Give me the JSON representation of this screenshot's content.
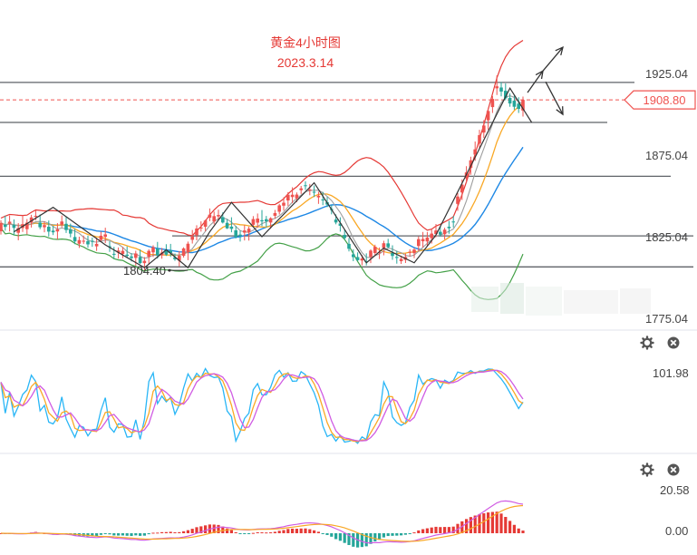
{
  "chart_data": [
    {
      "type": "candlestick",
      "title": "黄金4小时图",
      "subtitle": "2023.3.14",
      "y_ticks": [
        {
          "value": 1925,
          "label": "1925.04"
        },
        {
          "value": 1875,
          "label": "1875.04"
        },
        {
          "value": 1825,
          "label": "1825.04"
        },
        {
          "value": 1775,
          "label": "1775.04"
        }
      ],
      "ylim": [
        1771,
        1941
      ],
      "current_price": {
        "value": 1908.8,
        "label": "1908.80"
      },
      "low_marker": {
        "value": 1804.4,
        "label": "1804.40"
      },
      "horizontal_levels": [
        1919.5,
        1895,
        1862,
        1825.5,
        1806.5
      ],
      "candles_ohlc": [
        [
          1828.3,
          1835.1,
          1826.3,
          1833.4
        ],
        [
          1832.4,
          1837.9,
          1828.7,
          1831.0
        ],
        [
          1833.0,
          1838.0,
          1828.2,
          1834.2
        ],
        [
          1832.3,
          1835.6,
          1826.0,
          1830.4
        ],
        [
          1827.4,
          1833.3,
          1822.8,
          1830.3
        ],
        [
          1830.3,
          1838.1,
          1827.9,
          1832.7
        ],
        [
          1829.6,
          1835.8,
          1826.5,
          1833.6
        ],
        [
          1833.6,
          1838.4,
          1830.6,
          1836.8
        ],
        [
          1837.2,
          1841.2,
          1835.1,
          1837.8
        ],
        [
          1833.6,
          1838.6,
          1829.6,
          1830.8
        ],
        [
          1830.8,
          1834.4,
          1827.7,
          1832.1
        ],
        [
          1831.1,
          1834.9,
          1825.1,
          1828.1
        ],
        [
          1828.7,
          1831.6,
          1826.0,
          1827.7
        ],
        [
          1828.2,
          1833.3,
          1823.2,
          1829.5
        ],
        [
          1832.4,
          1838.0,
          1830.7,
          1834.3
        ],
        [
          1832.9,
          1837.4,
          1827.3,
          1829.1
        ],
        [
          1829.4,
          1833.0,
          1824.6,
          1826.9
        ],
        [
          1824.8,
          1829.8,
          1820.4,
          1822.1
        ],
        [
          1820.7,
          1825.0,
          1818.1,
          1822.9
        ],
        [
          1822.4,
          1825.7,
          1820.5,
          1822.5
        ],
        [
          1822.3,
          1825.6,
          1818.2,
          1820.3
        ],
        [
          1822.5,
          1824.5,
          1818.8,
          1821.9
        ],
        [
          1819.1,
          1824.4,
          1816.3,
          1820.6
        ],
        [
          1823.0,
          1828.1,
          1821.7,
          1825.6
        ],
        [
          1824.9,
          1830.5,
          1821.1,
          1826.4
        ],
        [
          1819.2,
          1822.2,
          1815.7,
          1819.0
        ],
        [
          1814.5,
          1818.8,
          1811.4,
          1814.4
        ],
        [
          1815.2,
          1818.4,
          1811.6,
          1816.5
        ],
        [
          1814.4,
          1818.6,
          1811.8,
          1816.3
        ],
        [
          1814.0,
          1819.0,
          1812.0,
          1813.2
        ],
        [
          1812.9,
          1814.9,
          1809.8,
          1811.9
        ],
        [
          1812.0,
          1816.4,
          1807.3,
          1814.7
        ],
        [
          1812.6,
          1817.2,
          1808.3,
          1808.8
        ],
        [
          1808.8,
          1812.5,
          1804.4,
          1810.2
        ],
        [
          1812.7,
          1817.3,
          1807.8,
          1816.3
        ],
        [
          1815.4,
          1819.7,
          1812.6,
          1818.6
        ],
        [
          1817.6,
          1821.8,
          1811.6,
          1813.6
        ],
        [
          1813.6,
          1818.1,
          1811.5,
          1815.3
        ],
        [
          1816.9,
          1820.4,
          1813.2,
          1814.0
        ],
        [
          1816.6,
          1820.6,
          1812.6,
          1815.0
        ],
        [
          1812.4,
          1814.7,
          1810.2,
          1811.2
        ],
        [
          1810.3,
          1816.2,
          1806.8,
          1813.3
        ],
        [
          1813.3,
          1818.5,
          1812.2,
          1817.8
        ],
        [
          1815.4,
          1822.0,
          1810.6,
          1820.7
        ],
        [
          1823.1,
          1829.1,
          1820.8,
          1825.1
        ],
        [
          1825.9,
          1832.0,
          1822.8,
          1830.0
        ],
        [
          1830.2,
          1834.4,
          1828.1,
          1830.6
        ],
        [
          1831.1,
          1835.4,
          1828.3,
          1834.9
        ],
        [
          1836.6,
          1842.3,
          1834.5,
          1838.5
        ],
        [
          1834.3,
          1840.4,
          1832.6,
          1837.6
        ],
        [
          1837.4,
          1841.5,
          1834.9,
          1838.3
        ],
        [
          1837.0,
          1839.9,
          1833.1,
          1833.7
        ],
        [
          1833.5,
          1835.7,
          1829.7,
          1830.1
        ],
        [
          1831.2,
          1836.9,
          1827.7,
          1829.8
        ],
        [
          1828.9,
          1831.6,
          1823.9,
          1824.7
        ],
        [
          1826.3,
          1828.7,
          1822.0,
          1825.4
        ],
        [
          1827.5,
          1832.1,
          1822.7,
          1828.8
        ],
        [
          1827.6,
          1831.2,
          1822.6,
          1829.9
        ],
        [
          1832.3,
          1837.6,
          1830.8,
          1835.8
        ],
        [
          1833.6,
          1839.2,
          1830.4,
          1836.1
        ],
        [
          1835.1,
          1841.3,
          1831.4,
          1834.4
        ],
        [
          1835.7,
          1837.7,
          1830.7,
          1834.4
        ],
        [
          1833.7,
          1836.9,
          1829.9,
          1836.3
        ],
        [
          1837.8,
          1841.4,
          1836.0,
          1839.5
        ],
        [
          1840.3,
          1845.1,
          1838.6,
          1844.2
        ],
        [
          1844.0,
          1849.2,
          1841.0,
          1845.8
        ],
        [
          1847.2,
          1852.3,
          1843.8,
          1850.7
        ],
        [
          1849.3,
          1855.3,
          1845.5,
          1850.7
        ],
        [
          1848.5,
          1852.1,
          1846.1,
          1850.8
        ],
        [
          1853.5,
          1856.1,
          1851.2,
          1854.6
        ],
        [
          1856.5,
          1858.9,
          1853.6,
          1856.1
        ],
        [
          1853.3,
          1857.3,
          1850.4,
          1853.9
        ],
        [
          1852.5,
          1856.4,
          1849.3,
          1852.2
        ],
        [
          1849.1,
          1852.6,
          1845.1,
          1850.1
        ],
        [
          1847.8,
          1852.4,
          1844.3,
          1847.4
        ],
        [
          1846.1,
          1849.3,
          1843.1,
          1844.7
        ],
        [
          1842.0,
          1844.6,
          1838.7,
          1841.3
        ],
        [
          1835.5,
          1838.7,
          1832.6,
          1833.7
        ],
        [
          1833.1,
          1836.9,
          1828.1,
          1831.7
        ],
        [
          1826.1,
          1829.5,
          1823.2,
          1824.2
        ],
        [
          1820.6,
          1824.2,
          1816.0,
          1817.6
        ],
        [
          1814.2,
          1817.3,
          1810.0,
          1812.5
        ],
        [
          1812.5,
          1815.4,
          1810.1,
          1810.6
        ],
        [
          1810.4,
          1813.8,
          1807.5,
          1811.6
        ],
        [
          1810.0,
          1814.8,
          1807.4,
          1809.7
        ],
        [
          1812.6,
          1817.3,
          1808.8,
          1816.5
        ],
        [
          1815.0,
          1820.1,
          1813.2,
          1818.8
        ],
        [
          1815.5,
          1818.4,
          1811.3,
          1815.6
        ],
        [
          1818.1,
          1822.5,
          1813.6,
          1821.0
        ],
        [
          1820.9,
          1823.7,
          1817.9,
          1818.6
        ],
        [
          1815.1,
          1819.7,
          1810.8,
          1813.2
        ],
        [
          1812.6,
          1816.4,
          1808.5,
          1812.0
        ],
        [
          1810.0,
          1813.3,
          1808.3,
          1811.4
        ],
        [
          1810.8,
          1814.7,
          1808.9,
          1812.6
        ],
        [
          1815.1,
          1817.3,
          1812.9,
          1815.7
        ],
        [
          1814.9,
          1818.1,
          1811.9,
          1817.1
        ],
        [
          1819.3,
          1825.2,
          1816.1,
          1823.5
        ],
        [
          1822.2,
          1827.9,
          1818.3,
          1823.6
        ],
        [
          1822.1,
          1827.9,
          1819.3,
          1824.5
        ],
        [
          1824.1,
          1830.1,
          1820.8,
          1826.9
        ],
        [
          1826.6,
          1832.8,
          1824.7,
          1828.8
        ],
        [
          1828.0,
          1831.1,
          1825.1,
          1826.3
        ],
        [
          1826.5,
          1830.5,
          1823.3,
          1829.3
        ],
        [
          1831.1,
          1834.7,
          1826.8,
          1830.2
        ],
        [
          1834.3,
          1837.7,
          1830.6,
          1834.0
        ],
        [
          1845.1,
          1851.7,
          1840.8,
          1849.6
        ],
        [
          1852.1,
          1860.1,
          1847.5,
          1856.9
        ],
        [
          1860.7,
          1868.2,
          1857.9,
          1864.4
        ],
        [
          1867.1,
          1874.0,
          1862.9,
          1871.8
        ],
        [
          1875.3,
          1883.3,
          1871.5,
          1878.5
        ],
        [
          1882.0,
          1890.5,
          1879.3,
          1887.2
        ],
        [
          1888.8,
          1896.4,
          1885.5,
          1893.1
        ],
        [
          1896.3,
          1903.6,
          1890.5,
          1902.0
        ],
        [
          1904.4,
          1911.2,
          1900.8,
          1909.4
        ],
        [
          1915.9,
          1923.8,
          1911.8,
          1917.1
        ],
        [
          1916.4,
          1919.7,
          1911.0,
          1913.9
        ],
        [
          1914.4,
          1918.9,
          1908.6,
          1909.8
        ],
        [
          1910.0,
          1912.8,
          1904.6,
          1906.6
        ],
        [
          1908.3,
          1911.4,
          1902.8,
          1904.6
        ],
        [
          1906.5,
          1910.4,
          1900.8,
          1903.3
        ],
        [
          1902.3,
          1910.8,
          1898.6,
          1908.8
        ]
      ],
      "indicator_panels": [
        {
          "value_label": "101.98",
          "tick_value": 101.98
        },
        {
          "value_label": "20.58",
          "tick_value": 20.58,
          "zero_label": "0.00"
        }
      ]
    }
  ],
  "icons": {
    "settings": "gear-icon",
    "close": "close-icon"
  },
  "colors": {
    "up": "#ef5350",
    "down": "#26a69a",
    "price_tag": "#ef5350",
    "text": "#444444",
    "title": "#e53935"
  }
}
